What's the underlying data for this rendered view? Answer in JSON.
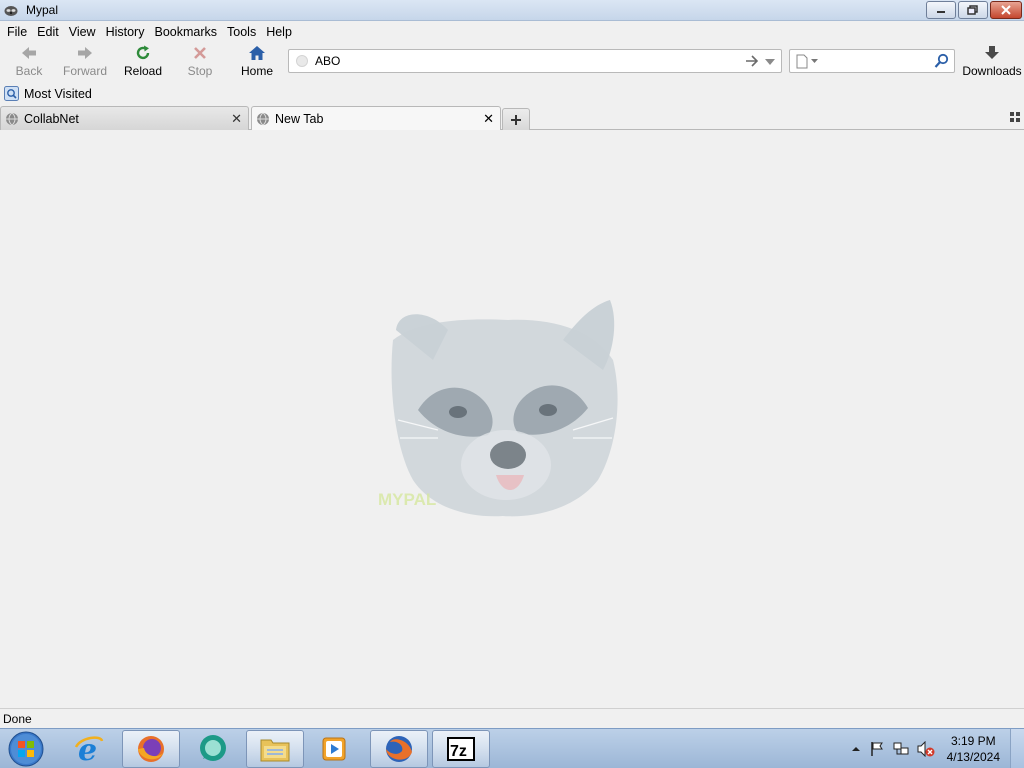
{
  "window": {
    "title": "Mypal"
  },
  "menu": [
    "File",
    "Edit",
    "View",
    "History",
    "Bookmarks",
    "Tools",
    "Help"
  ],
  "toolbar": {
    "back": "Back",
    "forward": "Forward",
    "reload": "Reload",
    "stop": "Stop",
    "home": "Home",
    "downloads": "Downloads"
  },
  "urlbar": {
    "value": "ABO"
  },
  "searchbar": {
    "value": ""
  },
  "bookmarks": {
    "most_visited": "Most Visited"
  },
  "tabs": [
    {
      "label": "CollabNet",
      "active": false
    },
    {
      "label": "New Tab",
      "active": true
    }
  ],
  "logo": {
    "text": "MYPAL"
  },
  "status": {
    "text": "Done"
  },
  "clock": {
    "time": "3:19 PM",
    "date": "4/13/2024"
  },
  "colors": {
    "accent": "#1c5fb0",
    "reload_green": "#2e8b3a",
    "stop_red": "#c0504d",
    "titlebar": "#c6d6ea"
  }
}
